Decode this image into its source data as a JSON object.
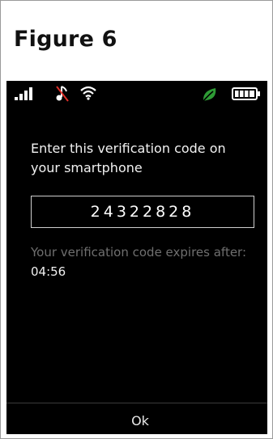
{
  "figure": {
    "title": "Figure 6"
  },
  "statusbar": {
    "signal_icon": "signal-bars-icon",
    "music_icon": "music-off-icon",
    "wifi_icon": "wifi-icon",
    "leaf_icon": "eco-leaf-icon",
    "battery_icon": "battery-full-icon",
    "leaf_color": "#2e9b35"
  },
  "main": {
    "prompt": "Enter this verification code on your smartphone",
    "code": "24322828",
    "expiry_label": "Your verification code expires after: ",
    "expiry_time": "04:56"
  },
  "softkeys": {
    "center_label": "Ok"
  }
}
